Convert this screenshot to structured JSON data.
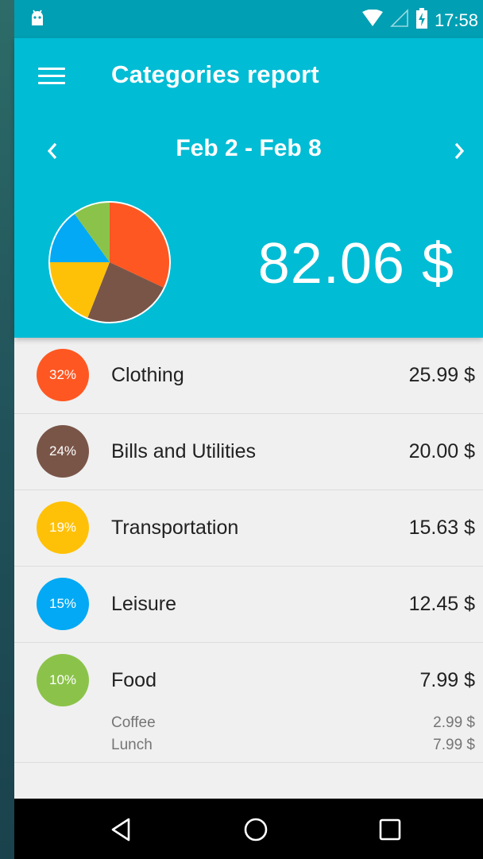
{
  "status_bar": {
    "time": "17:58",
    "icons": [
      "android-debug-icon",
      "wifi-icon",
      "signal-icon",
      "battery-charging-icon"
    ]
  },
  "app_bar": {
    "menu_icon": "menu-icon",
    "title": "Categories report",
    "date_range": "Feb 2 - Feb 8",
    "prev_icon": "chevron-left-icon",
    "next_icon": "chevron-right-icon",
    "total": "82.06 $"
  },
  "chart_data": {
    "type": "pie",
    "values": [
      32,
      24,
      19,
      15,
      10
    ],
    "colors": [
      "#ff5722",
      "#795548",
      "#ffc107",
      "#03a9f4",
      "#8bc34a"
    ]
  },
  "categories": [
    {
      "percent": "32%",
      "name": "Clothing",
      "amount": "25.99 $",
      "color": "#ff5722"
    },
    {
      "percent": "24%",
      "name": "Bills and Utilities",
      "amount": "20.00 $",
      "color": "#795548"
    },
    {
      "percent": "19%",
      "name": "Transportation",
      "amount": "15.63 $",
      "color": "#ffc107"
    },
    {
      "percent": "15%",
      "name": "Leisure",
      "amount": "12.45 $",
      "color": "#03a9f4"
    },
    {
      "percent": "10%",
      "name": "Food",
      "amount": "7.99 $",
      "color": "#8bc34a",
      "items": [
        {
          "name": "Coffee",
          "amount": "2.99 $"
        },
        {
          "name": "Lunch",
          "amount": "7.99 $"
        }
      ]
    }
  ],
  "nav_bar": {
    "icons": [
      "back-icon",
      "home-icon",
      "recents-icon"
    ]
  },
  "colors": {
    "primary": "#00bcd4",
    "primary_dark": "#009fb3",
    "list_background": "#f0f0f0"
  }
}
